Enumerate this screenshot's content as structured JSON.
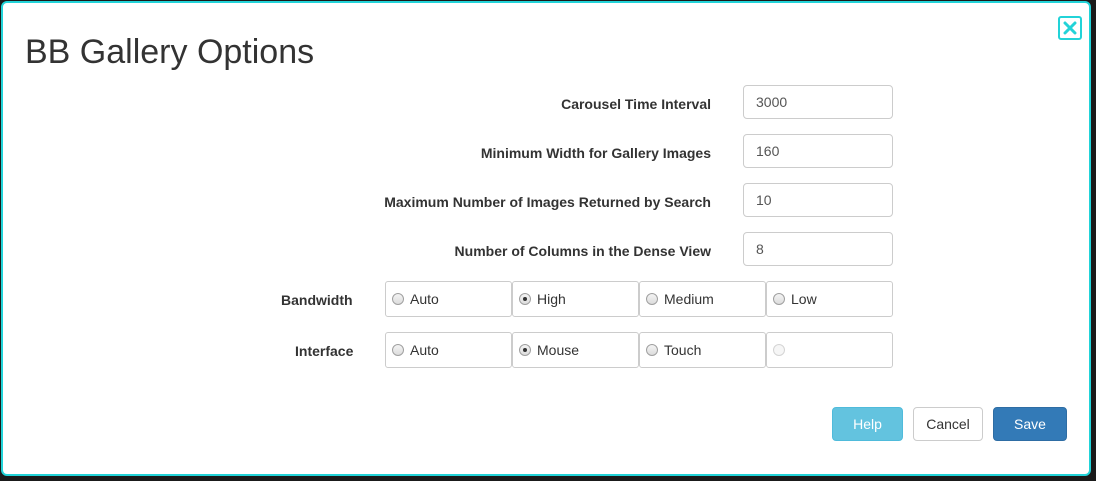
{
  "dialog": {
    "title": "BB Gallery Options",
    "close_icon": "close-icon",
    "accent_color": "#22d3d8"
  },
  "fields": {
    "carousel_interval": {
      "label": "Carousel Time Interval",
      "value": "3000"
    },
    "min_width": {
      "label": "Minimum Width for Gallery Images",
      "value": "160"
    },
    "max_images": {
      "label": "Maximum Number of Images Returned by Search",
      "value": "10"
    },
    "dense_columns": {
      "label": "Number of Columns in the Dense View",
      "value": "8"
    }
  },
  "bandwidth": {
    "label": "Bandwidth",
    "options": [
      {
        "label": "Auto",
        "checked": false
      },
      {
        "label": "High",
        "checked": true
      },
      {
        "label": "Medium",
        "checked": false
      },
      {
        "label": "Low",
        "checked": false
      }
    ]
  },
  "interface": {
    "label": "Interface",
    "options": [
      {
        "label": "Auto",
        "checked": false
      },
      {
        "label": "Mouse",
        "checked": true
      },
      {
        "label": "Touch",
        "checked": false
      },
      {
        "label": "",
        "checked": false,
        "disabled": true
      }
    ]
  },
  "buttons": {
    "help": "Help",
    "cancel": "Cancel",
    "save": "Save"
  }
}
